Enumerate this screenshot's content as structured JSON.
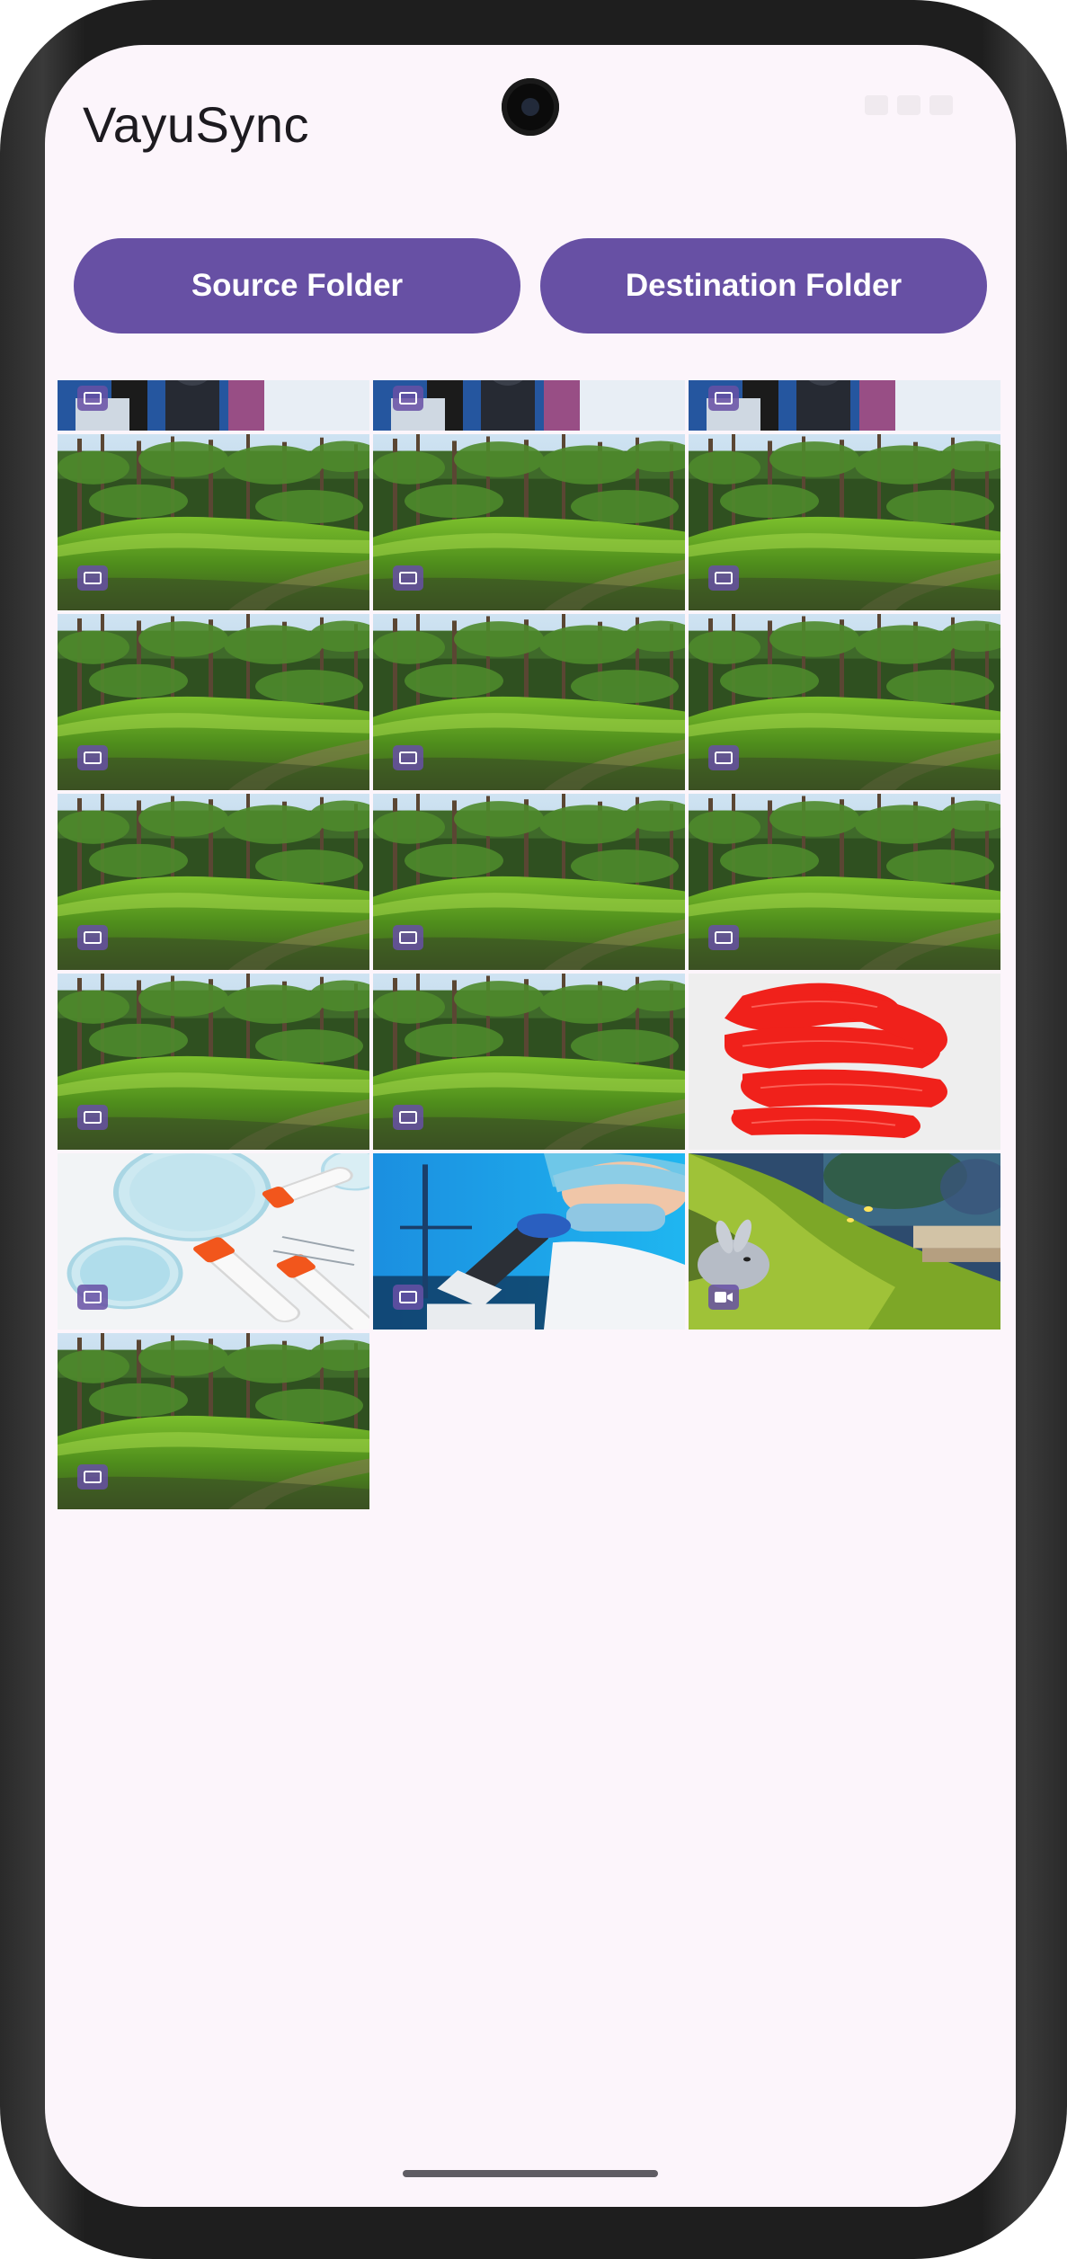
{
  "app": {
    "title": "VayuSync"
  },
  "actions": {
    "source_label": "Source Folder",
    "destination_label": "Destination Folder"
  },
  "colors": {
    "primary": "#6750a4",
    "background": "#fcf5fb",
    "on_primary": "#ffffff",
    "title_text": "#1d1b20"
  },
  "gallery": {
    "columns": 3,
    "items": [
      {
        "subject": "scientist-microscope",
        "media": "image"
      },
      {
        "subject": "scientist-microscope",
        "media": "image"
      },
      {
        "subject": "scientist-microscope",
        "media": "image"
      },
      {
        "subject": "forest-clearing",
        "media": "image"
      },
      {
        "subject": "forest-clearing",
        "media": "image"
      },
      {
        "subject": "forest-clearing",
        "media": "image"
      },
      {
        "subject": "forest-clearing",
        "media": "image"
      },
      {
        "subject": "forest-clearing",
        "media": "image"
      },
      {
        "subject": "forest-clearing",
        "media": "image"
      },
      {
        "subject": "forest-clearing",
        "media": "image"
      },
      {
        "subject": "forest-clearing",
        "media": "image"
      },
      {
        "subject": "forest-clearing",
        "media": "image"
      },
      {
        "subject": "forest-clearing",
        "media": "image"
      },
      {
        "subject": "forest-clearing",
        "media": "image"
      },
      {
        "subject": "red-paint-stroke",
        "media": "image-no-badge"
      },
      {
        "subject": "lab-petri-dishes",
        "media": "image"
      },
      {
        "subject": "scientist-closeup",
        "media": "image"
      },
      {
        "subject": "animated-rabbit-meadow",
        "media": "video"
      },
      {
        "subject": "forest-clearing",
        "media": "image"
      }
    ]
  }
}
